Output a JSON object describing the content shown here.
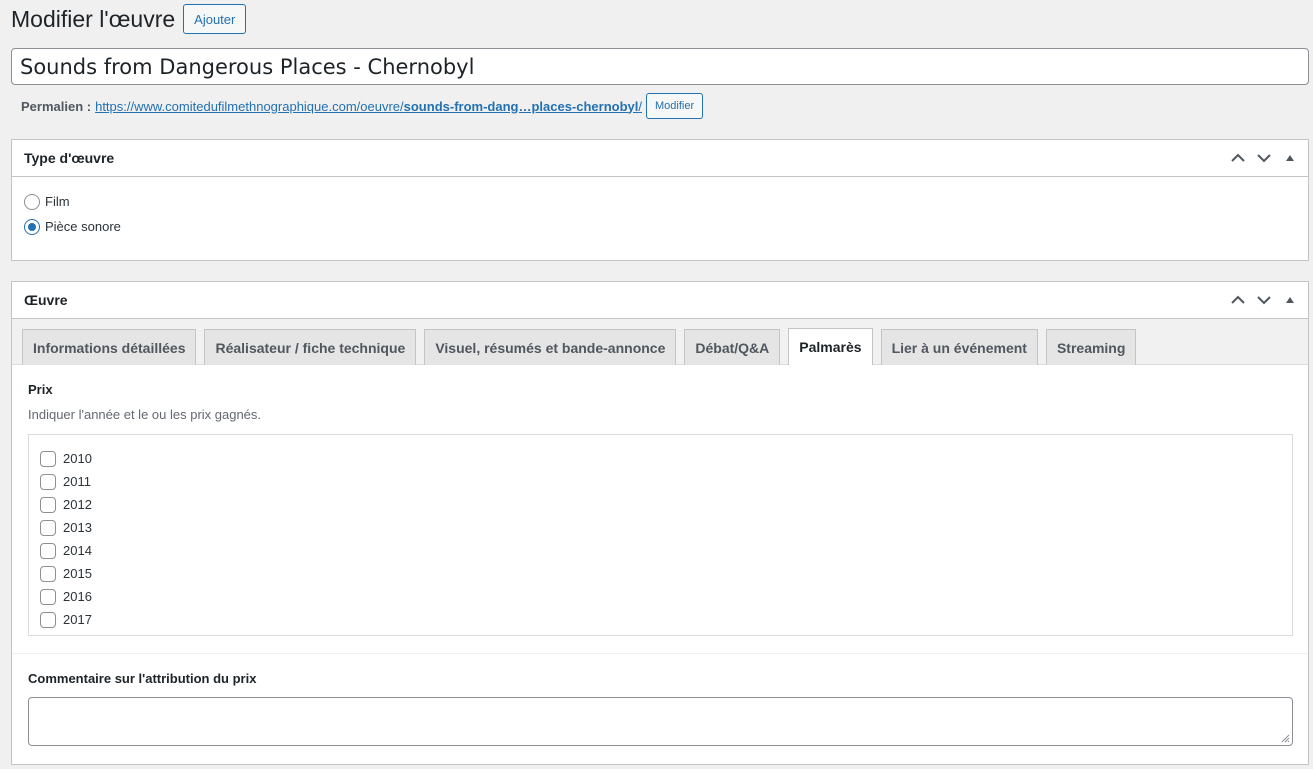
{
  "header": {
    "title": "Modifier l'œuvre",
    "add_button": "Ajouter"
  },
  "post_title": {
    "value": "Sounds from Dangerous Places - Chernobyl"
  },
  "permalink": {
    "label": "Permalien :",
    "url_base": "https://www.comitedufilmethnographique.com/oeuvre/",
    "slug": "sounds-from-dang…places-chernobyl",
    "trailing_slash": "/",
    "modify_button": "Modifier"
  },
  "type_box": {
    "title": "Type d'œuvre",
    "options": [
      {
        "label": "Film",
        "checked": false
      },
      {
        "label": "Pièce sonore",
        "checked": true
      }
    ]
  },
  "oeuvre_box": {
    "title": "Œuvre",
    "tabs": [
      {
        "label": "Informations détaillées",
        "active": false
      },
      {
        "label": "Réalisateur / fiche technique",
        "active": false
      },
      {
        "label": "Visuel, résumés et bande-annonce",
        "active": false
      },
      {
        "label": "Débat/Q&A",
        "active": false
      },
      {
        "label": "Palmarès",
        "active": true
      },
      {
        "label": "Lier à un événement",
        "active": false
      },
      {
        "label": "Streaming",
        "active": false
      }
    ],
    "prix": {
      "label": "Prix",
      "description": "Indiquer l'année et le ou les prix gagnés.",
      "years": [
        "2010",
        "2011",
        "2012",
        "2013",
        "2014",
        "2015",
        "2016",
        "2017"
      ]
    },
    "comment": {
      "label": "Commentaire sur l'attribution du prix",
      "value": ""
    }
  },
  "colors": {
    "accent": "#2271b1",
    "background": "#f0f0f1",
    "border": "#c3c4c7"
  },
  "icons": [
    "chevron-up-icon",
    "chevron-down-icon",
    "toggle-arrow-icon",
    "resize-grip-icon"
  ]
}
